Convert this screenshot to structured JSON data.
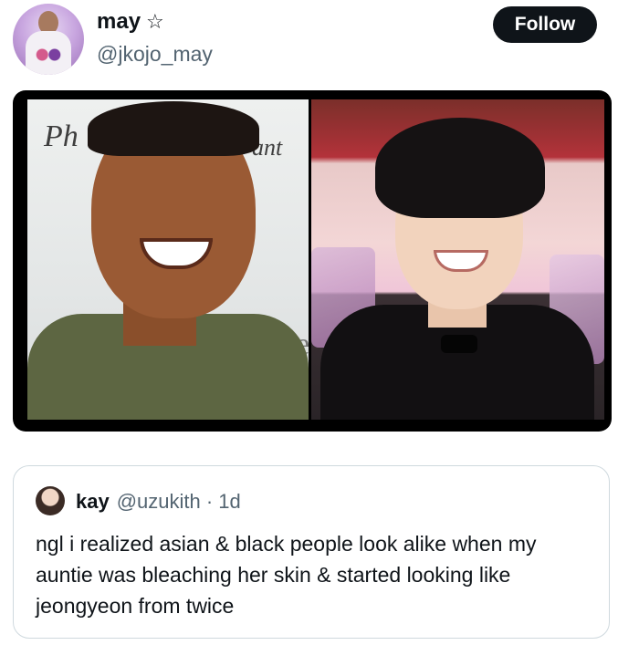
{
  "post": {
    "author_name": "may",
    "handle": "@jkojo_may",
    "follow_label": "Follow",
    "star_icon": "star-outline-icon"
  },
  "media": {
    "left_photo_text": [
      "Ph",
      "ant",
      "ebe"
    ]
  },
  "quoted_post": {
    "author_name": "kay",
    "handle_time": "@uzukith · 1d",
    "text": "ngl i realized asian & black people look alike when my auntie was bleaching her skin & started looking like jeongyeon from twice"
  }
}
